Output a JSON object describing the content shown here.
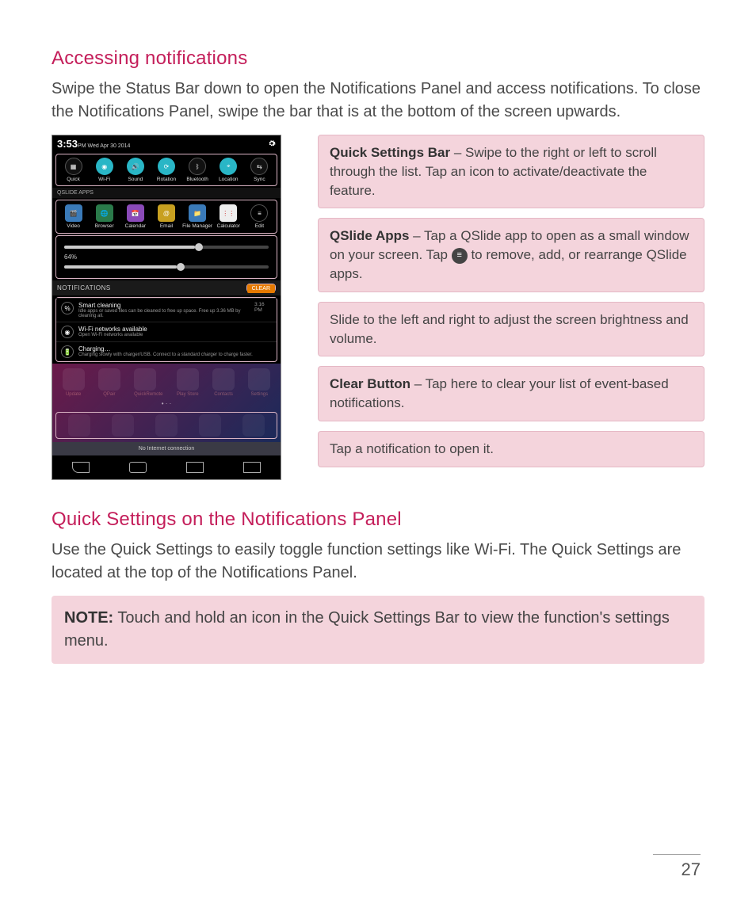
{
  "page_number": "27",
  "sections": {
    "accessing": {
      "heading": "Accessing notifications",
      "body": "Swipe the Status Bar down to open the Notifications Panel and access notifications. To close the Notifications Panel, swipe the bar that is at the bottom of the screen upwards."
    },
    "quick_settings": {
      "heading": "Quick Settings on the Notifications Panel",
      "body": "Use the Quick Settings to easily toggle function settings like Wi-Fi. The Quick Settings are located at the top of the Notifications Panel.",
      "note_label": "NOTE:",
      "note_body": " Touch and hold an icon in the Quick Settings Bar to view the function's settings menu."
    }
  },
  "phone": {
    "time": "3:53",
    "time_suffix": "PM Wed Apr 30 2014",
    "qs_label": "QSLIDE APPS",
    "quick_settings": [
      {
        "label": "Quick"
      },
      {
        "label": "Wi-Fi"
      },
      {
        "label": "Sound"
      },
      {
        "label": "Rotation"
      },
      {
        "label": "Bluetooth"
      },
      {
        "label": "Location"
      },
      {
        "label": "Sync"
      }
    ],
    "qslide_apps": [
      {
        "label": "Video",
        "color": "#3a7ab8"
      },
      {
        "label": "Browser",
        "color": "#2a7a4a"
      },
      {
        "label": "Calendar",
        "color": "#8a4ab8"
      },
      {
        "label": "Email",
        "color": "#c8a020"
      },
      {
        "label": "File Manager",
        "color": "#3a7ab8"
      },
      {
        "label": "Calculator",
        "color": "#d8d8d8"
      },
      {
        "label": "Edit",
        "color": "#555"
      }
    ],
    "brightness_pct": "64%",
    "notif_header": "NOTIFICATIONS",
    "clear_label": "CLEAR",
    "notifications": [
      {
        "title": "Smart cleaning",
        "sub": "Idle apps or saved files can be cleaned to free up space. Free up 3.36 MB by cleaning all.",
        "time": "3:16 PM"
      },
      {
        "title": "Wi-Fi networks available",
        "sub": "Open Wi-Fi networks available",
        "time": ""
      },
      {
        "title": "Charging…",
        "sub": "Charging slowly with charger/USB. Connect to a standard charger to charge faster.",
        "time": ""
      }
    ],
    "home_labels": [
      "Update",
      "QPair",
      "QuickRemote",
      "Play Store",
      "Contacts",
      "Settings"
    ],
    "weather_text": "No Internet connection"
  },
  "callouts": [
    {
      "bold": "Quick Settings Bar",
      "text": " – Swipe to the right or left to scroll through the list. Tap an icon to activate/deactivate the feature."
    },
    {
      "bold": "QSlide Apps",
      "text_before": " – Tap a QSlide app to open as a small window on your screen. Tap ",
      "text_after": " to remove, add, or rearrange QSlide apps."
    },
    {
      "bold": "",
      "text": "Slide to the left and right to adjust the screen brightness and volume."
    },
    {
      "bold": "Clear Button",
      "text": " – Tap here to clear your list of event-based notifications."
    },
    {
      "bold": "",
      "text": "Tap a notification to open it."
    }
  ]
}
